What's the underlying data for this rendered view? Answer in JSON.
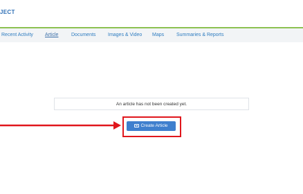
{
  "header": {
    "brand": "JECT"
  },
  "tabs": [
    {
      "label": "Recent Activity",
      "active": false
    },
    {
      "label": "Article",
      "active": true
    },
    {
      "label": "Documents",
      "active": false
    },
    {
      "label": "Images & Video",
      "active": false
    },
    {
      "label": "Maps",
      "active": false
    },
    {
      "label": "Summaries & Reports",
      "active": false
    }
  ],
  "main": {
    "notice": "An article has not been created yet.",
    "create_button": "Create Article"
  },
  "colors": {
    "accent": "#3f7fce",
    "header_rule": "#8cc152",
    "annotation": "#e0161c"
  },
  "icons": {
    "button_icon": "keyboard-icon",
    "annotation": "arrow-right-icon"
  }
}
